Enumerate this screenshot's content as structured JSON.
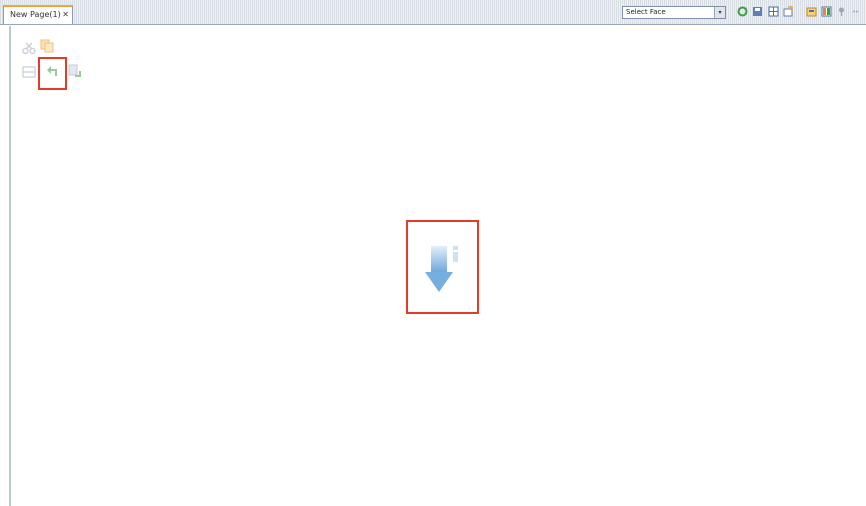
{
  "editor_tab": {
    "title": "New Page(1)",
    "close_glyph": "✕"
  },
  "toolbar": {
    "perspective_select": {
      "value": "Select Face",
      "arrow": "▾"
    },
    "icons": [
      "refresh-icon",
      "save-icon",
      "grid-icon",
      "export-icon",
      "layout-icon",
      "palette-icon",
      "pin-icon",
      "more-icon"
    ]
  },
  "palette": {
    "row1": [
      "cut-icon",
      "copy-icon"
    ],
    "row2": [
      "table-icon",
      "undo-icon",
      "redo-icon"
    ]
  },
  "center_icon": "download-arrow-icon",
  "colors": {
    "highlight": "#e53b2a",
    "tab_accent": "#f0a43a",
    "arrow_blue": "#8fbde3"
  }
}
